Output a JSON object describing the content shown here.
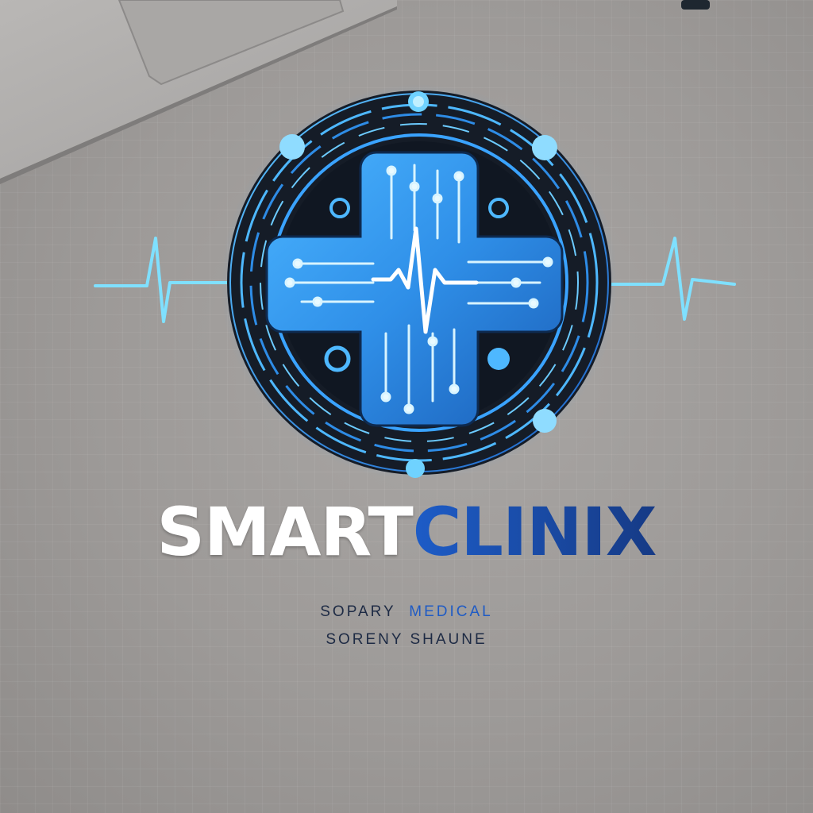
{
  "brand": {
    "name_part1": "SMART",
    "name_part2": "CLINIX",
    "tagline_line1_a": "SOPARY",
    "tagline_line1_b": "MEDICAL",
    "tagline_line2": "SORENY SHAUNE"
  },
  "colors": {
    "background": "#9d9a98",
    "emblem_dark": "#151c27",
    "emblem_accent": "#3aa3ff",
    "wordmark_white": "#ffffff",
    "wordmark_blue": "#1a49a8",
    "tagline_dark": "#1d2a44"
  },
  "icons": [
    "medical-cross-icon",
    "heartbeat-icon",
    "circuit-node-icon"
  ]
}
